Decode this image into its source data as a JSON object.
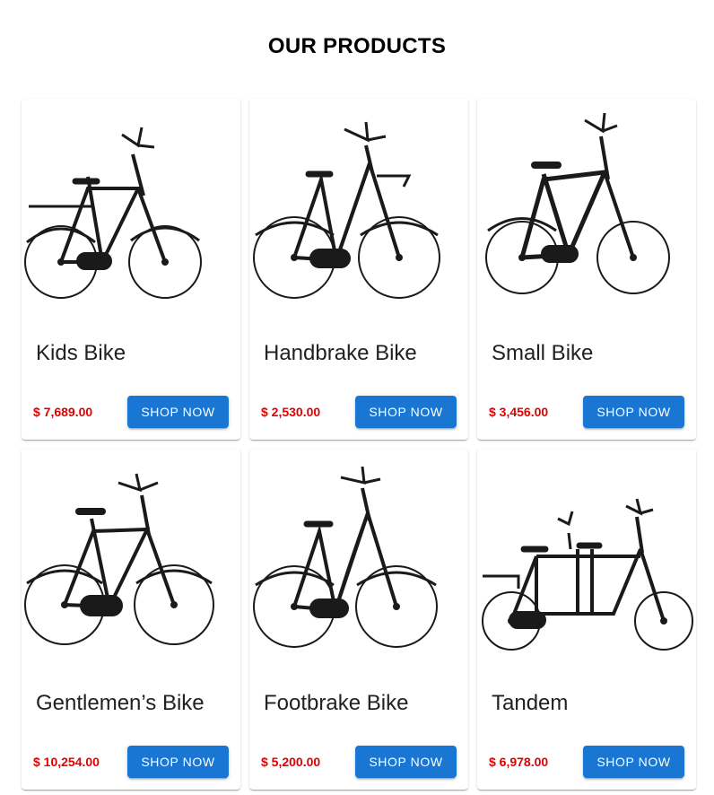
{
  "page": {
    "title": "OUR PRODUCTS"
  },
  "products": [
    {
      "name": "Kids Bike",
      "price": "$ 7,689.00",
      "button_label": "SHOP NOW",
      "image_icon": "bicycle-icon"
    },
    {
      "name": "Handbrake Bike",
      "price": "$ 2,530.00",
      "button_label": "SHOP NOW",
      "image_icon": "bicycle-icon"
    },
    {
      "name": "Small Bike",
      "price": "$ 3,456.00",
      "button_label": "SHOP NOW",
      "image_icon": "bicycle-icon"
    },
    {
      "name": "Gentlemen’s Bike",
      "price": "$ 10,254.00",
      "button_label": "SHOP NOW",
      "image_icon": "bicycle-icon"
    },
    {
      "name": "Footbrake Bike",
      "price": "$ 5,200.00",
      "button_label": "SHOP NOW",
      "image_icon": "bicycle-icon"
    },
    {
      "name": "Tandem",
      "price": "$ 6,978.00",
      "button_label": "SHOP NOW",
      "image_icon": "tandem-bicycle-icon"
    }
  ],
  "colors": {
    "price": "#e00000",
    "button": "#1976d2",
    "bike": "#1a1a1a"
  }
}
